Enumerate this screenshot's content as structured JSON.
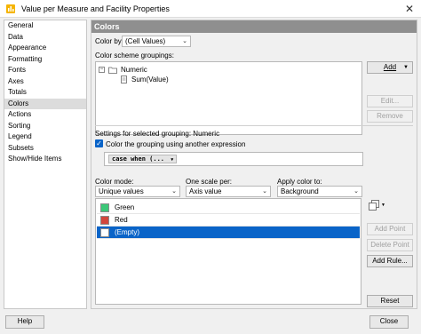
{
  "window": {
    "title": "Value per Measure and Facility Properties"
  },
  "nav": {
    "items": [
      "General",
      "Data",
      "Appearance",
      "Formatting",
      "Fonts",
      "Axes",
      "Totals",
      "Colors",
      "Actions",
      "Sorting",
      "Legend",
      "Subsets",
      "Show/Hide Items"
    ],
    "selected": "Colors"
  },
  "panel": {
    "title": "Colors",
    "color_by_label": "Color by:",
    "color_by_value": "(Cell Values)",
    "groupings_label": "Color scheme groupings:",
    "tree": {
      "root": "Numeric",
      "child": "Sum(Value)"
    },
    "buttons": {
      "add": "Add",
      "edit": "Edit...",
      "remove": "Remove"
    },
    "settings_label": "Settings for selected grouping: Numeric",
    "checkbox_label": "Color the grouping using another expression",
    "expression": "case  when (...",
    "color_mode_label": "Color mode:",
    "color_mode_value": "Unique values",
    "one_scale_label": "One scale per:",
    "one_scale_value": "Axis value",
    "apply_color_label": "Apply color to:",
    "apply_color_value": "Background",
    "values": [
      {
        "label": "Green",
        "color": "#3cc878"
      },
      {
        "label": "Red",
        "color": "#d2463c"
      },
      {
        "label": "(Empty)",
        "color": "#ffffff"
      }
    ],
    "value_buttons": {
      "add_point": "Add Point",
      "delete_point": "Delete Point",
      "add_rule": "Add Rule...",
      "reset": "Reset"
    }
  },
  "footer": {
    "help": "Help",
    "close": "Close"
  }
}
